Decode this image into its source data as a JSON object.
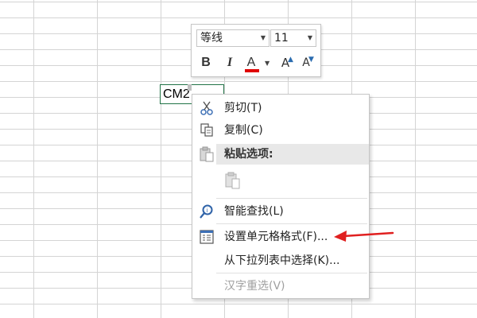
{
  "cell": {
    "text": "CM2"
  },
  "mini_toolbar": {
    "font_name": "等线",
    "font_size": "11",
    "bold_label": "B",
    "italic_label": "I",
    "font_color_label": "A",
    "grow_label": "A",
    "shrink_label": "A",
    "font_color": "#e00000"
  },
  "context_menu": {
    "items": [
      {
        "label": "剪切(T)",
        "icon": "scissors-icon"
      },
      {
        "label": "复制(C)",
        "icon": "copy-icon"
      },
      {
        "label": "粘贴选项:",
        "icon": "paste-icon"
      },
      {
        "label": "智能查找(L)",
        "icon": "search-icon"
      },
      {
        "label": "设置单元格格式(F)...",
        "icon": "format-cells-icon"
      },
      {
        "label": "从下拉列表中选择(K)..."
      },
      {
        "label": "汉字重选(V)",
        "disabled": true
      }
    ]
  },
  "annotation": {
    "color": "#e02020"
  }
}
